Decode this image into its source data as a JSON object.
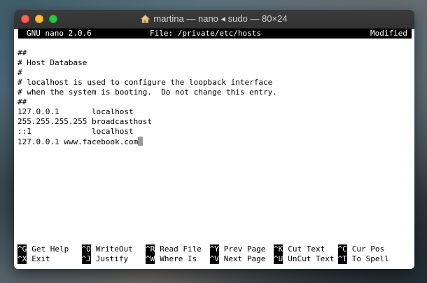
{
  "window": {
    "title": "martina — nano ◂ sudo — 80×24"
  },
  "nano": {
    "version": "GNU nano 2.0.6",
    "file": "File: /private/etc/hosts",
    "status": "Modified"
  },
  "file_lines": [
    "",
    "##",
    "# Host Database",
    "#",
    "# localhost is used to configure the loopback interface",
    "# when the system is booting.  Do not change this entry.",
    "##",
    "127.0.0.1       localhost",
    "255.255.255.255 broadcasthost",
    "::1             localhost",
    "127.0.0.1 www.facebook.com"
  ],
  "shortcuts": {
    "row1": [
      {
        "key": "^G",
        "label": "Get Help"
      },
      {
        "key": "^O",
        "label": "WriteOut"
      },
      {
        "key": "^R",
        "label": "Read File"
      },
      {
        "key": "^Y",
        "label": "Prev Page"
      },
      {
        "key": "^K",
        "label": "Cut Text"
      },
      {
        "key": "^C",
        "label": "Cur Pos"
      }
    ],
    "row2": [
      {
        "key": "^X",
        "label": "Exit"
      },
      {
        "key": "^J",
        "label": "Justify"
      },
      {
        "key": "^W",
        "label": "Where Is"
      },
      {
        "key": "^V",
        "label": "Next Page"
      },
      {
        "key": "^U",
        "label": "UnCut Text"
      },
      {
        "key": "^T",
        "label": "To Spell"
      }
    ]
  }
}
